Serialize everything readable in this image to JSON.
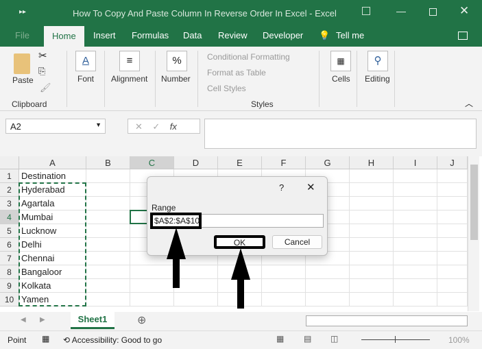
{
  "window": {
    "title": "How To Copy And Paste Column In Reverse Order In Excel  -  Excel"
  },
  "tabs": [
    "File",
    "Home",
    "Insert",
    "Formulas",
    "Data",
    "Review",
    "Developer",
    "Tell me"
  ],
  "ribbon": {
    "paste": "Paste",
    "clipboard": "Clipboard",
    "font": "Font",
    "alignment": "Alignment",
    "number": "Number",
    "conditional_formatting": "Conditional Formatting",
    "format_as_table": "Format as Table",
    "cell_styles": "Cell Styles",
    "styles": "Styles",
    "cells": "Cells",
    "editing": "Editing"
  },
  "formula_bar": {
    "name_box": "A2",
    "fx": "fx",
    "value": ""
  },
  "columns": [
    "A",
    "B",
    "C",
    "D",
    "E",
    "F",
    "G",
    "H",
    "I",
    "J"
  ],
  "rows": [
    "1",
    "2",
    "3",
    "4",
    "5",
    "6",
    "7",
    "8",
    "9",
    "10"
  ],
  "column_a": [
    "Destination",
    "Hyderabad",
    "Agartala",
    "Mumbai",
    "Lucknow",
    "Delhi",
    "Chennai",
    "Bangaloor",
    "Kolkata",
    "Yamen"
  ],
  "dialog": {
    "help": "?",
    "label": "Range",
    "value": "$A$2:$A$10",
    "ok": "OK",
    "cancel": "Cancel"
  },
  "sheet_tab": "Sheet1",
  "status": {
    "mode": "Point",
    "accessibility": "Accessibility: Good to go",
    "zoom": "100%"
  },
  "colors": {
    "brand": "#217346"
  }
}
